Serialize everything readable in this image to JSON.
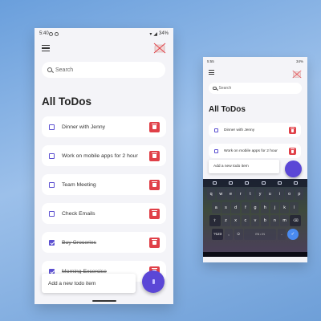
{
  "phone_a": {
    "status": {
      "time": "5:40",
      "battery": "34%"
    },
    "search": {
      "placeholder": "Search"
    },
    "title": "All ToDos",
    "todos": [
      {
        "text": "Dinner with Jenny",
        "done": false
      },
      {
        "text": "Work on mobile apps for 2 hour",
        "done": false
      },
      {
        "text": "Team Meeting",
        "done": false
      },
      {
        "text": "Check Emails",
        "done": false
      },
      {
        "text": "Buy Groceries",
        "done": true
      },
      {
        "text": "Morning Excercise",
        "done": true
      }
    ],
    "add_input": {
      "placeholder": "Add a new todo item"
    },
    "fab_icon": "plus-icon"
  },
  "phone_b": {
    "status": {
      "time": "5:55",
      "battery": "34%"
    },
    "search": {
      "placeholder": "Search"
    },
    "title": "All ToDos",
    "todos": [
      {
        "text": "Dinner with Jenny",
        "done": false
      },
      {
        "text": "Work on mobile apps for 2 hour",
        "done": false
      }
    ],
    "add_input": {
      "placeholder": "Add a new todo item"
    },
    "keyboard": {
      "row1": [
        "q",
        "w",
        "e",
        "r",
        "t",
        "y",
        "u",
        "i",
        "o",
        "p"
      ],
      "row2": [
        "a",
        "s",
        "d",
        "f",
        "g",
        "h",
        "j",
        "k",
        "l"
      ],
      "row3": [
        "z",
        "x",
        "c",
        "v",
        "b",
        "n",
        "m"
      ],
      "symbols_key": "?123",
      "space_label": "EN • IN"
    }
  },
  "colors": {
    "accent": "#5b47d6",
    "delete": "#e04048",
    "checkbox": "#5b4fd0"
  }
}
